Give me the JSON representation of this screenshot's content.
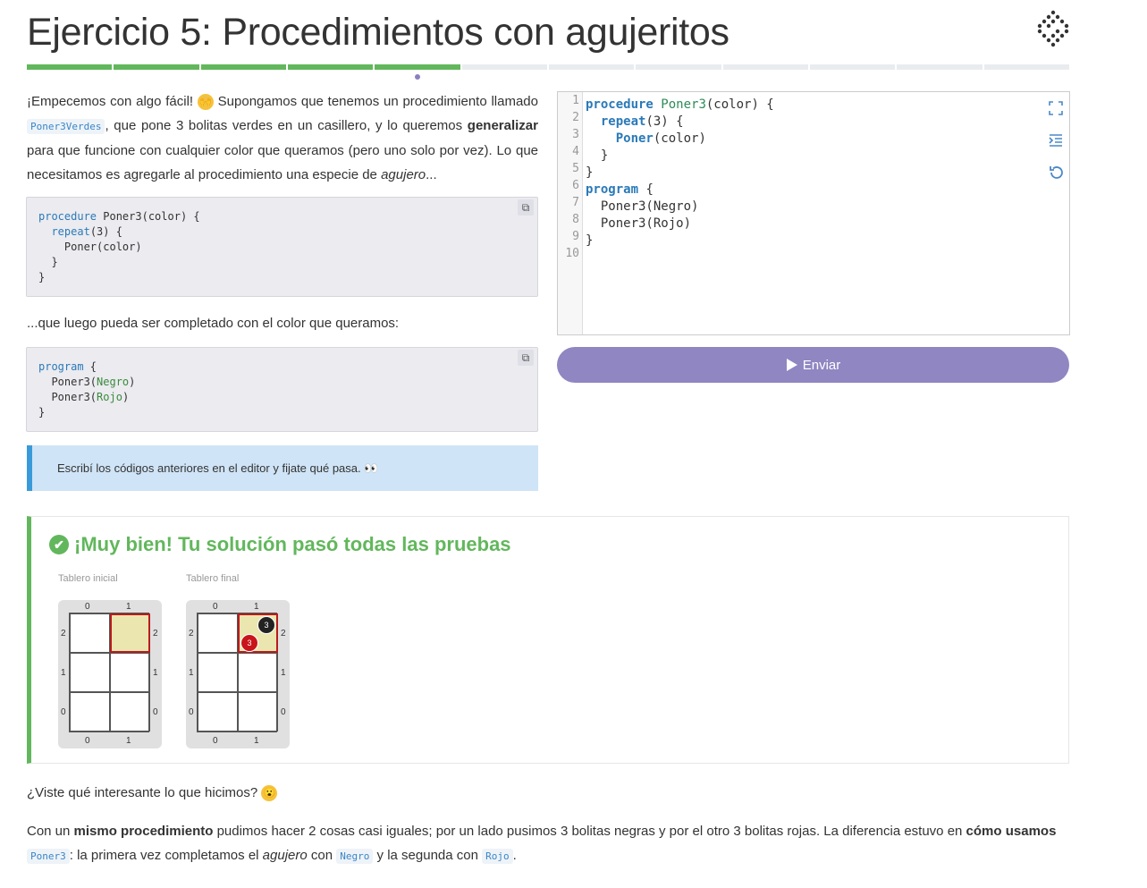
{
  "title": "Ejercicio 5: Procedimientos con agujeritos",
  "progress": {
    "total": 12,
    "completed": 5
  },
  "intro": {
    "t1": "¡Empecemos con algo fácil! ",
    "emoji1": "🙌",
    "t2": " Supongamos que tenemos un procedimiento llamado ",
    "code1": "Poner3Verdes",
    "t3": ", que pone 3 bolitas verdes en un casillero, y lo queremos ",
    "bold1": "generalizar",
    "t4": " para que funcione con cualquier color que queramos (pero uno solo por vez). Lo que necesitamos es agregarle al procedimiento una especie de ",
    "em1": "agujero",
    "t5": "..."
  },
  "code_block_1": {
    "l1_kw": "procedure",
    "l1_rest": " Poner3(color) {",
    "l2_kw": "repeat",
    "l2_rest": "(3) {",
    "l3": "Poner(color)",
    "l4": "}",
    "l5": "}"
  },
  "middle_text": "...que luego pueda ser completado con el color que queramos:",
  "code_block_2": {
    "l1_kw": "program",
    "l1_rest": " {",
    "l2a": "Poner3(",
    "l2b": "Negro",
    "l2c": ")",
    "l3a": "Poner3(",
    "l3b": "Rojo",
    "l3c": ")",
    "l4": "}"
  },
  "alert_text": "Escribí los códigos anteriores en el editor y fijate qué pasa. 👀",
  "editor": {
    "line_numbers": [
      "1",
      "2",
      "3",
      "4",
      "5",
      "6",
      "7",
      "8",
      "9",
      "10"
    ],
    "icons": [
      "fullscreen-icon",
      "indent-icon",
      "reset-icon"
    ]
  },
  "send_label": "Enviar",
  "result": {
    "title": "¡Muy bien! Tu solución pasó todas las pruebas",
    "initial_label": "Tablero inicial",
    "final_label": "Tablero final",
    "col_labels": [
      "0",
      "1"
    ],
    "row_labels": [
      "2",
      "1",
      "0"
    ],
    "balls": {
      "black": "3",
      "red": "3"
    }
  },
  "bottom": {
    "q": "¿Viste qué interesante lo que hicimos? ",
    "emoji": "😮",
    "p1": "Con un ",
    "b1": "mismo procedimiento",
    "p2": " pudimos hacer 2 cosas casi iguales; por un lado pusimos 3 bolitas negras y por el otro 3 bolitas rojas. La diferencia estuvo en ",
    "b2": "cómo usamos",
    "c1": "Poner3",
    "p3": ": la primera vez completamos el ",
    "em": "agujero",
    "p4": " con ",
    "c2": "Negro",
    "p5": " y la segunda con ",
    "c3": "Rojo",
    "p6": "."
  },
  "colors": {
    "accent": "#8f86c2",
    "success": "#62b75c",
    "info": "#3a9ad9"
  }
}
